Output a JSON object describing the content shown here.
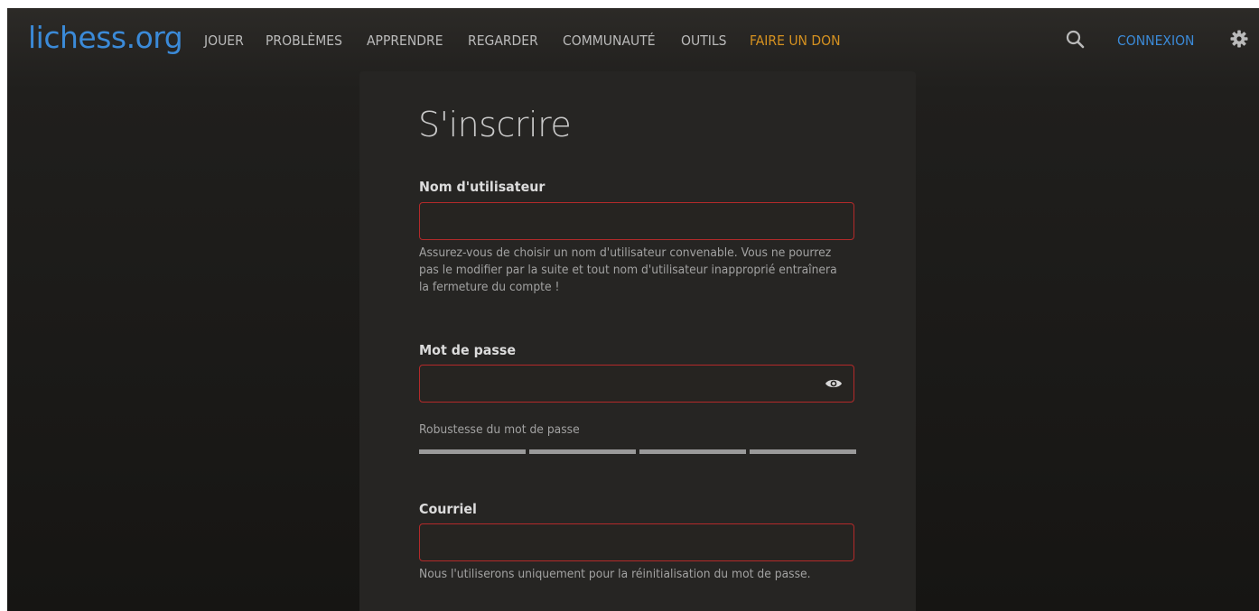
{
  "header": {
    "logo": "lichess.org",
    "nav": [
      {
        "label": "JOUER"
      },
      {
        "label": "PROBLÈMES"
      },
      {
        "label": "APPRENDRE"
      },
      {
        "label": "REGARDER"
      },
      {
        "label": "COMMUNAUTÉ"
      },
      {
        "label": "OUTILS"
      },
      {
        "label": "FAIRE UN DON"
      }
    ],
    "search_icon": "search-icon",
    "login_label": "CONNEXION",
    "settings_icon": "gear-icon"
  },
  "form": {
    "title": "S'inscrire",
    "username": {
      "label": "Nom d'utilisateur",
      "value": "",
      "help": "Assurez-vous de choisir un nom d'utilisateur convenable. Vous ne pourrez pas le modifier par la suite et tout nom d'utilisateur inapproprié entraînera la fermeture du compte !"
    },
    "password": {
      "label": "Mot de passe",
      "value": "",
      "toggle_icon": "eye-icon",
      "strength_label": "Robustesse du mot de passe",
      "strength_segments": 4,
      "strength_filled": 0
    },
    "email": {
      "label": "Courriel",
      "value": "",
      "help": "Nous l'utiliserons uniquement pour la réinitialisation du mot de passe."
    }
  },
  "colors": {
    "accent": "#3b8ad8",
    "donate": "#d59120",
    "error_border": "#b32a2a",
    "background": "#161513",
    "panel": "#262523"
  }
}
